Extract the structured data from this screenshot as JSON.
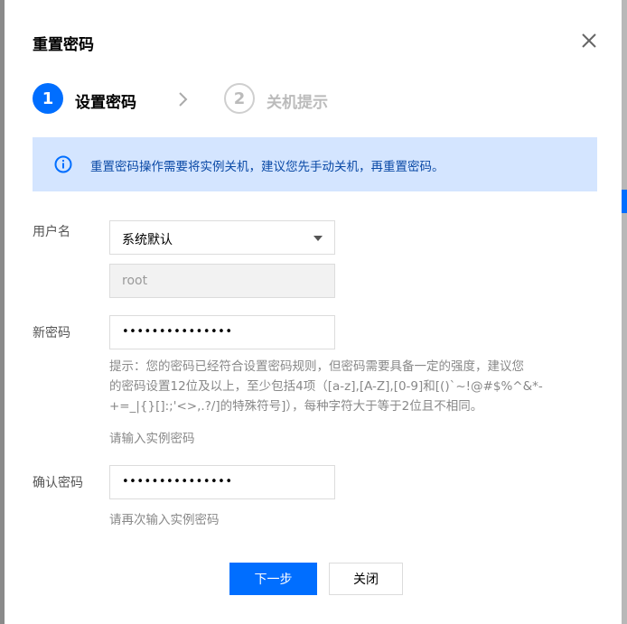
{
  "dialog": {
    "title": "重置密码",
    "close_icon": "close-icon"
  },
  "steps": [
    {
      "number": "1",
      "label": "设置密码",
      "state": "active"
    },
    {
      "number": "2",
      "label": "关机提示",
      "state": "inactive"
    }
  ],
  "notice": {
    "icon": "info-icon",
    "text": "重置密码操作需要将实例关机，建议您先手动关机，再重置密码。"
  },
  "form": {
    "username": {
      "label": "用户名",
      "select_value": "系统默认",
      "input_value": "root"
    },
    "new_password": {
      "label": "新密码",
      "value": "•••••••••••••••",
      "hint_lines": [
        "提示：您的密码已经符合设置密码规则，但密码需要具备一定的强度，建议您",
        "的密码设置12位及以上，至少包括4项（[a-z],[A-Z],[0-9]和[()`~!@#$%^&*-",
        "+=_|{}[]:;'<>,.?/]的特殊符号]），每种字符大于等于2位且不相同。"
      ],
      "sub_hint": "请输入实例密码"
    },
    "confirm_password": {
      "label": "确认密码",
      "value": "•••••••••••••••",
      "sub_hint": "请再次输入实例密码"
    }
  },
  "buttons": {
    "next": "下一步",
    "close": "关闭"
  },
  "colors": {
    "primary": "#006eff",
    "notice_bg": "#d4e5ff",
    "notice_text": "#0b4aa6"
  }
}
